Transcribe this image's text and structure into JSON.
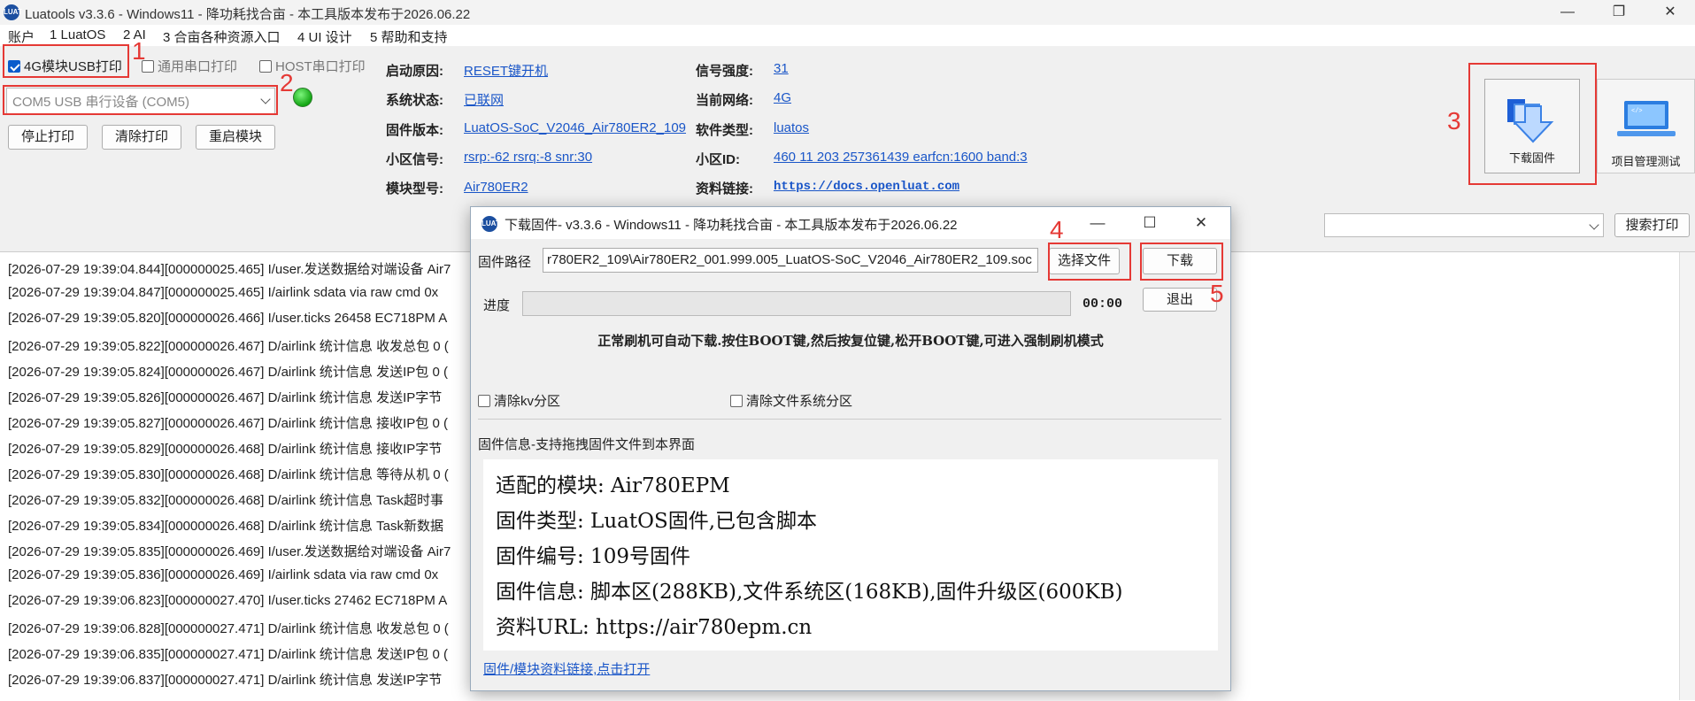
{
  "window": {
    "title": "Luatools  v3.3.6 - Windows11 - 降功耗找合亩 - 本工具版本发布于2026.06.22",
    "logo_text": "LUAT"
  },
  "menu": [
    "账户",
    "1 LuatOS",
    "2 AI",
    "3 合亩各种资源入口",
    "4 UI 设计",
    "5 帮助和支持"
  ],
  "toolbar": {
    "cb_4g": "4G模块USB打印",
    "cb_serial": "通用串口打印",
    "cb_host": "HOST串口打印",
    "port_select": "COM5 USB 串行设备 (COM5)",
    "stop_print": "停止打印",
    "clear_print": "清除打印",
    "restart_module": "重启模块",
    "download_fw": "下载固件",
    "project_mgmt": "项目管理测试",
    "search_print": "搜索打印"
  },
  "info": {
    "boot_reason_label": "启动原因:",
    "boot_reason": "RESET键开机",
    "sys_status_label": "系统状态:",
    "sys_status": "已联网",
    "fw_version_label": "固件版本:",
    "fw_version": "LuatOS-SoC_V2046_Air780ER2_109",
    "cell_signal_label": "小区信号:",
    "cell_signal": "rsrp:-62 rsrq:-8 snr:30",
    "module_model_label": "模块型号:",
    "module_model": "Air780ER2",
    "signal_strength_label": "信号强度:",
    "signal_strength": "31",
    "network_label": "当前网络:",
    "network": "4G",
    "sw_type_label": "软件类型:",
    "sw_type": "luatos",
    "cell_id_label": "小区ID:",
    "cell_id": "460 11 203 257361439 earfcn:1600 band:3",
    "doc_link_label": "资料链接:",
    "doc_link": "https://docs.openluat.com"
  },
  "annotations": [
    "1",
    "2",
    "3",
    "4",
    "5"
  ],
  "log": [
    "[2026-07-29 19:39:04.844][000000025.465] I/user.发送数据给对端设备 Air7",
    "[2026-07-29 19:39:04.847][000000025.465] I/airlink sdata via raw cmd 0x",
    "[2026-07-29 19:39:05.820][000000026.466] I/user.ticks 26458 EC718PM A",
    "[2026-07-29 19:39:05.822][000000026.467] D/airlink 统计信息 收发总包 0 (",
    "[2026-07-29 19:39:05.824][000000026.467] D/airlink 统计信息 发送IP包 0 (",
    "[2026-07-29 19:39:05.826][000000026.467] D/airlink 统计信息 发送IP字节",
    "[2026-07-29 19:39:05.827][000000026.467] D/airlink 统计信息 接收IP包 0 (",
    "[2026-07-29 19:39:05.829][000000026.468] D/airlink 统计信息 接收IP字节",
    "[2026-07-29 19:39:05.830][000000026.468] D/airlink 统计信息 等待从机 0 (",
    "[2026-07-29 19:39:05.832][000000026.468] D/airlink 统计信息 Task超时事",
    "[2026-07-29 19:39:05.834][000000026.468] D/airlink 统计信息 Task新数据",
    "[2026-07-29 19:39:05.835][000000026.469] I/user.发送数据给对端设备 Air7",
    "[2026-07-29 19:39:05.836][000000026.469] I/airlink sdata via raw cmd 0x",
    "[2026-07-29 19:39:06.823][000000027.470] I/user.ticks 27462 EC718PM A",
    "[2026-07-29 19:39:06.828][000000027.471] D/airlink 统计信息 收发总包 0 (",
    "[2026-07-29 19:39:06.835][000000027.471] D/airlink 统计信息 发送IP包 0 (",
    "[2026-07-29 19:39:06.837][000000027.471] D/airlink 统计信息 发送IP字节"
  ],
  "dialog": {
    "title": "下载固件- v3.3.6 - Windows11 - 降功耗找合亩 - 本工具版本发布于2026.06.22",
    "fw_path_label": "固件路径",
    "fw_path": "r780ER2_109\\Air780ER2_001.999.005_LuatOS-SoC_V2046_Air780ER2_109.soc",
    "choose_file": "选择文件",
    "download": "下载",
    "progress_label": "进度",
    "progress_time": "00:00",
    "progress_value": 0,
    "exit": "退出",
    "notice": "正常刷机可自动下载.按住BOOT键,然后按复位键,松开BOOT键,可进入强制刷机模式",
    "clear_kv": "清除kv分区",
    "clear_fs": "清除文件系统分区",
    "fw_info_title": "固件信息-支持拖拽固件文件到本界面",
    "fw_info_lines": [
      "适配的模块: Air780EPM",
      "固件类型: LuatOS固件,已包含脚本",
      "固件编号: 109号固件",
      "固件信息: 脚本区(288KB),文件系统区(168KB),固件升级区(600KB)",
      "资料URL: https://air780epm.cn"
    ],
    "fw_link": "固件/模块资料链接,点击打开"
  }
}
